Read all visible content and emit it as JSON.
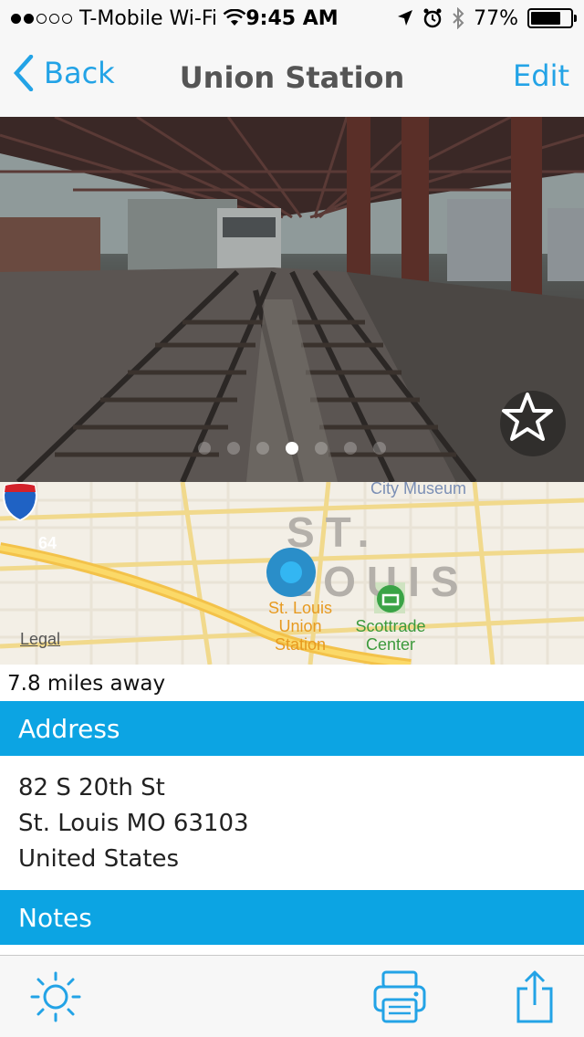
{
  "status_bar": {
    "carrier": "T-Mobile Wi-Fi",
    "time": "9:45 AM",
    "battery": "77%",
    "battery_level": 0.77,
    "signal_filled": 2,
    "signal_total": 5
  },
  "nav": {
    "back_label": "Back",
    "title": "Union Station",
    "edit_label": "Edit"
  },
  "photo": {
    "page_count": 7,
    "active_page": 4,
    "favorite_icon": "star-outline-icon"
  },
  "map": {
    "city_label": "ST. LOUIS",
    "museum_label": "City Museum",
    "station_label": "St. Louis Union Station",
    "center_label": "Scottrade Center",
    "highway_label": "64",
    "legal_label": "Legal"
  },
  "distance": "7.8 miles away",
  "address": {
    "header": "Address",
    "lines": [
      "82 S 20th St",
      "St. Louis MO 63103",
      "United States"
    ]
  },
  "notes": {
    "header": "Notes"
  },
  "toolbar": {
    "items": [
      "brightness-icon",
      "print-icon",
      "share-icon"
    ]
  },
  "colors": {
    "accent": "#23a3e6",
    "section": "#0ca4e3"
  }
}
